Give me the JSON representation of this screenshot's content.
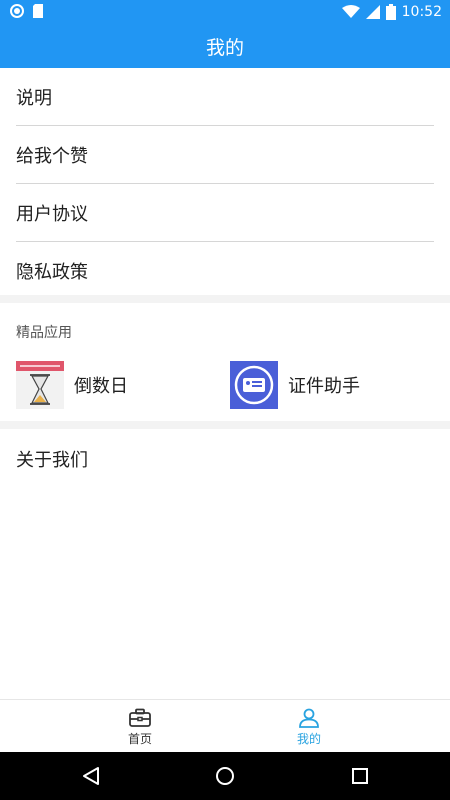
{
  "status": {
    "time": "10:52"
  },
  "header": {
    "title": "我的"
  },
  "menu": {
    "items": [
      "说明",
      "给我个赞",
      "用户协议",
      "隐私政策"
    ]
  },
  "apps": {
    "section_title": "精品应用",
    "items": [
      {
        "label": "倒数日",
        "icon": "hourglass-icon"
      },
      {
        "label": "证件助手",
        "icon": "id-card-icon"
      }
    ]
  },
  "about": {
    "label": "关于我们"
  },
  "tabbar": {
    "tabs": [
      {
        "label": "首页",
        "icon": "briefcase-icon",
        "active": false
      },
      {
        "label": "我的",
        "icon": "user-icon",
        "active": true
      }
    ],
    "active_color": "#29a3e0",
    "inactive_color": "#333333"
  },
  "colors": {
    "primary": "#2196f3"
  }
}
